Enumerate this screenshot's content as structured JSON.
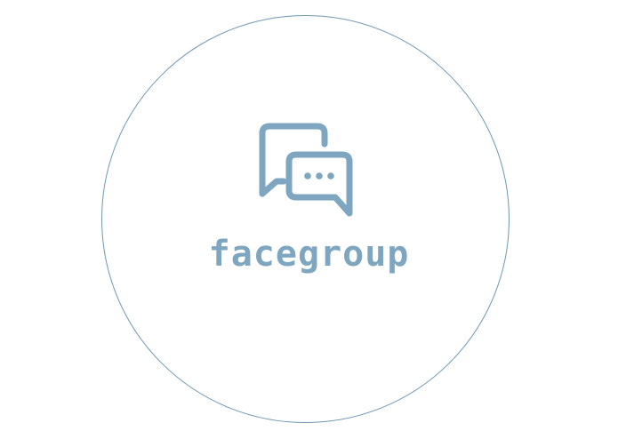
{
  "brand": {
    "name": "facegroup",
    "icon": "chat-bubbles-icon",
    "color": "#7ea6c0",
    "ring_color": "#6f97b1"
  }
}
